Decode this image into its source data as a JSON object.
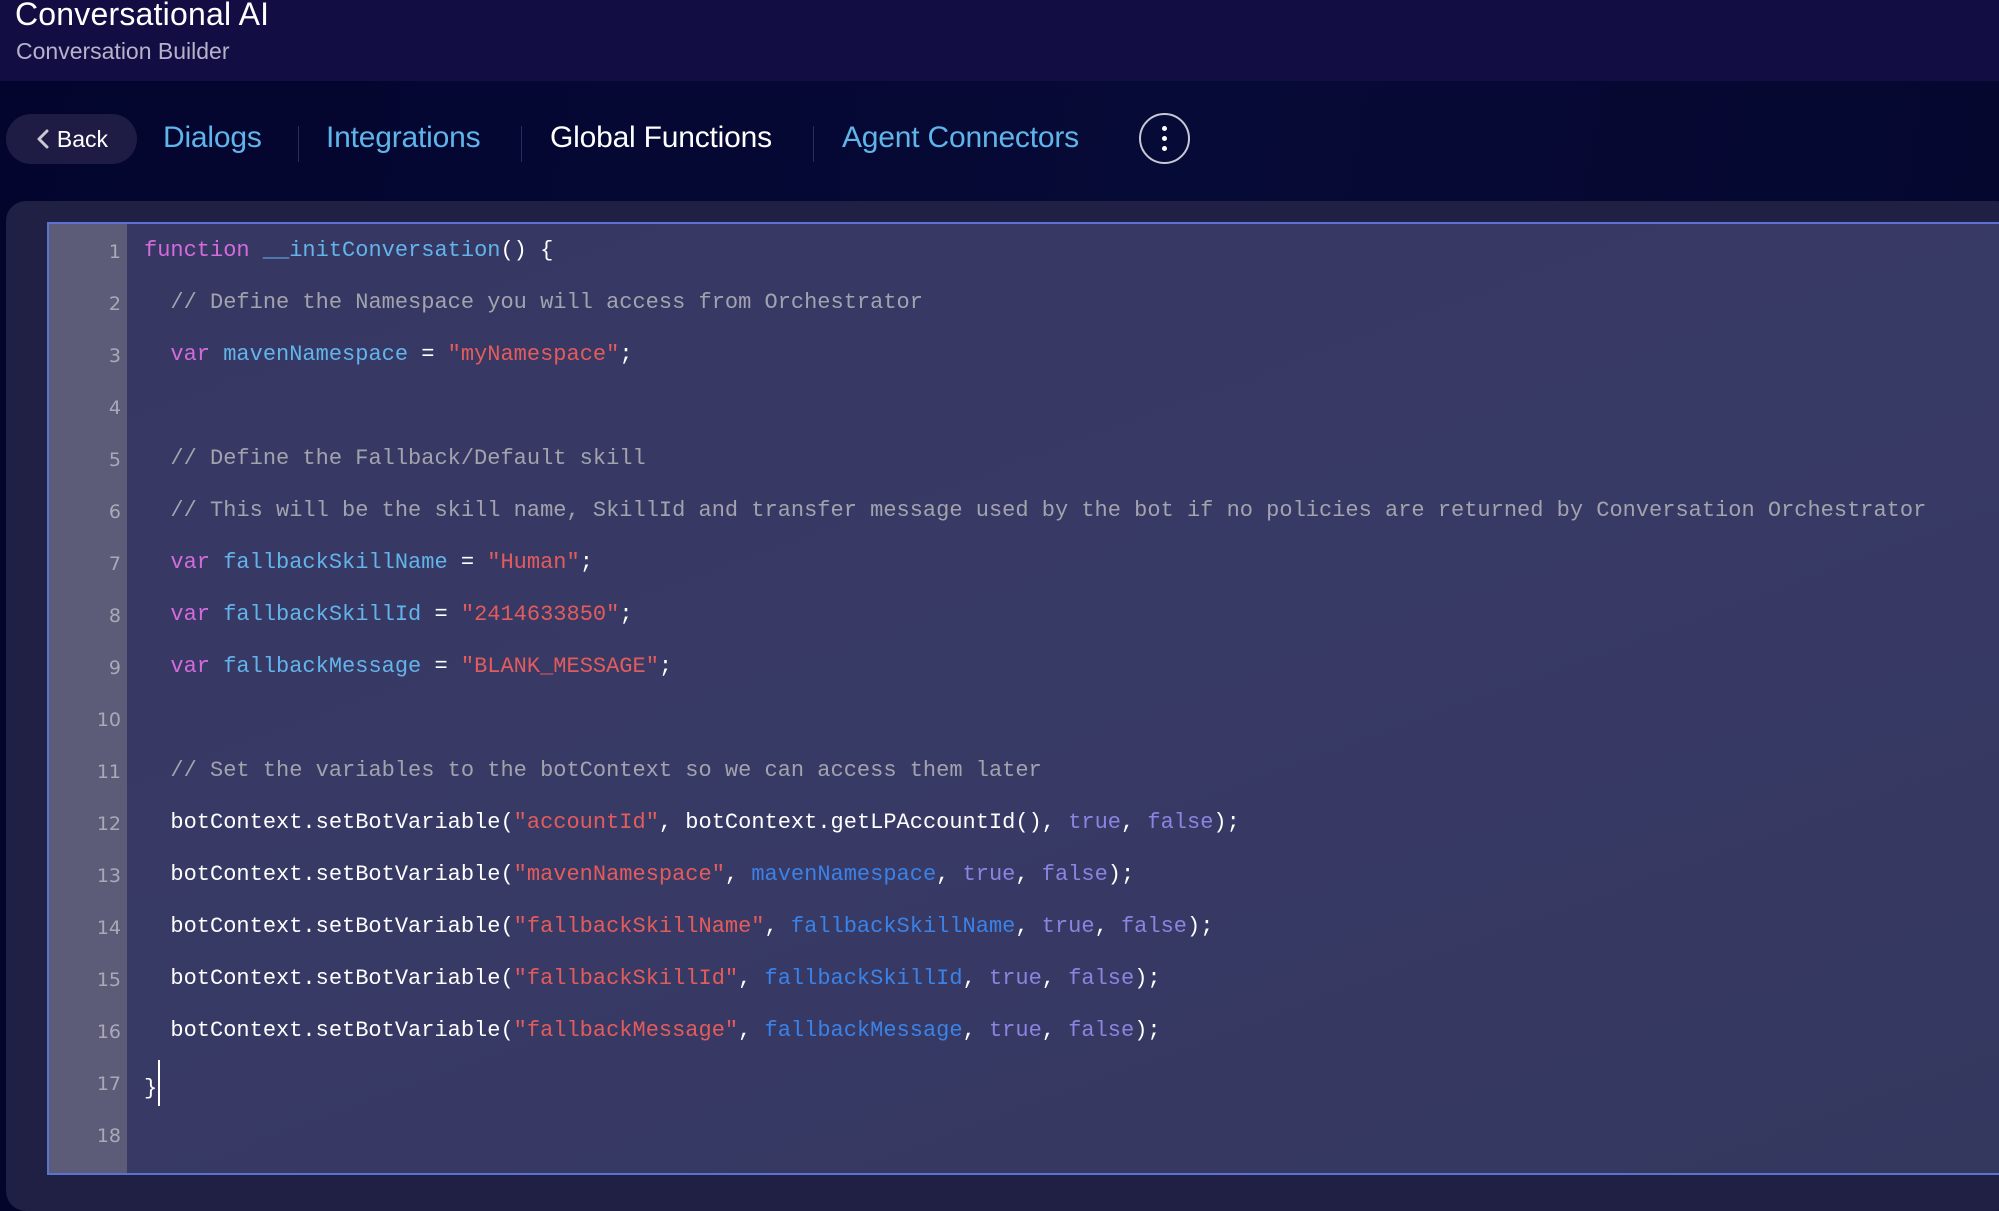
{
  "header": {
    "title": "Conversational AI",
    "subtitle": "Conversation Builder"
  },
  "nav": {
    "back_label": "Back",
    "tabs": [
      {
        "label": "Dialogs",
        "active": false
      },
      {
        "label": "Integrations",
        "active": false
      },
      {
        "label": "Global Functions",
        "active": true
      },
      {
        "label": "Agent Connectors",
        "active": false
      }
    ],
    "more_icon": "vertical-ellipsis-icon"
  },
  "colors": {
    "header_bg": "#120e44",
    "nav_bg": "#03052e",
    "tab_link": "#5fb4ea",
    "tab_active": "#ffffff",
    "editor_border": "#5a73d0",
    "keyword": "#d46bdc",
    "identifier": "#62b4ea",
    "reference": "#3b82e8",
    "string": "#e35c5c",
    "comment": "#a3a3ad",
    "boolean": "#8b84e0"
  },
  "editor": {
    "cursor_line": 17,
    "lines": [
      {
        "n": "1",
        "tokens": [
          {
            "t": "kw",
            "v": "function"
          },
          {
            "t": "plain",
            "v": " "
          },
          {
            "t": "fn",
            "v": "__initConversation"
          },
          {
            "t": "plain",
            "v": "() {"
          }
        ]
      },
      {
        "n": "2",
        "tokens": [
          {
            "t": "plain",
            "v": "  "
          },
          {
            "t": "com",
            "v": "// Define the Namespace you will access from Orchestrator"
          }
        ]
      },
      {
        "n": "3",
        "tokens": [
          {
            "t": "plain",
            "v": "  "
          },
          {
            "t": "kw",
            "v": "var"
          },
          {
            "t": "plain",
            "v": " "
          },
          {
            "t": "var",
            "v": "mavenNamespace"
          },
          {
            "t": "plain",
            "v": " = "
          },
          {
            "t": "str",
            "v": "\"myNamespace\""
          },
          {
            "t": "plain",
            "v": ";"
          }
        ]
      },
      {
        "n": "4",
        "tokens": []
      },
      {
        "n": "5",
        "tokens": [
          {
            "t": "plain",
            "v": "  "
          },
          {
            "t": "com",
            "v": "// Define the Fallback/Default skill"
          }
        ]
      },
      {
        "n": "6",
        "tokens": [
          {
            "t": "plain",
            "v": "  "
          },
          {
            "t": "com",
            "v": "// This will be the skill name, SkillId and transfer message used by the bot if no policies are returned by Conversation Orchestrator"
          }
        ]
      },
      {
        "n": "7",
        "tokens": [
          {
            "t": "plain",
            "v": "  "
          },
          {
            "t": "kw",
            "v": "var"
          },
          {
            "t": "plain",
            "v": " "
          },
          {
            "t": "var",
            "v": "fallbackSkillName"
          },
          {
            "t": "plain",
            "v": " = "
          },
          {
            "t": "str",
            "v": "\"Human\""
          },
          {
            "t": "plain",
            "v": ";"
          }
        ]
      },
      {
        "n": "8",
        "tokens": [
          {
            "t": "plain",
            "v": "  "
          },
          {
            "t": "kw",
            "v": "var"
          },
          {
            "t": "plain",
            "v": " "
          },
          {
            "t": "var",
            "v": "fallbackSkillId"
          },
          {
            "t": "plain",
            "v": " = "
          },
          {
            "t": "str",
            "v": "\"2414633850\""
          },
          {
            "t": "plain",
            "v": ";"
          }
        ]
      },
      {
        "n": "9",
        "tokens": [
          {
            "t": "plain",
            "v": "  "
          },
          {
            "t": "kw",
            "v": "var"
          },
          {
            "t": "plain",
            "v": " "
          },
          {
            "t": "var",
            "v": "fallbackMessage"
          },
          {
            "t": "plain",
            "v": " = "
          },
          {
            "t": "str",
            "v": "\"BLANK_MESSAGE\""
          },
          {
            "t": "plain",
            "v": ";"
          }
        ]
      },
      {
        "n": "10",
        "tokens": []
      },
      {
        "n": "11",
        "tokens": [
          {
            "t": "plain",
            "v": "  "
          },
          {
            "t": "com",
            "v": "// Set the variables to the botContext so we can access them later"
          }
        ]
      },
      {
        "n": "12",
        "tokens": [
          {
            "t": "plain",
            "v": "  botContext.setBotVariable("
          },
          {
            "t": "str",
            "v": "\"accountId\""
          },
          {
            "t": "plain",
            "v": ", botContext.getLPAccountId(), "
          },
          {
            "t": "bool",
            "v": "true"
          },
          {
            "t": "plain",
            "v": ", "
          },
          {
            "t": "bool",
            "v": "false"
          },
          {
            "t": "plain",
            "v": ");"
          }
        ]
      },
      {
        "n": "13",
        "tokens": [
          {
            "t": "plain",
            "v": "  botContext.setBotVariable("
          },
          {
            "t": "str",
            "v": "\"mavenNamespace\""
          },
          {
            "t": "plain",
            "v": ", "
          },
          {
            "t": "ref",
            "v": "mavenNamespace"
          },
          {
            "t": "plain",
            "v": ", "
          },
          {
            "t": "bool",
            "v": "true"
          },
          {
            "t": "plain",
            "v": ", "
          },
          {
            "t": "bool",
            "v": "false"
          },
          {
            "t": "plain",
            "v": ");"
          }
        ]
      },
      {
        "n": "14",
        "tokens": [
          {
            "t": "plain",
            "v": "  botContext.setBotVariable("
          },
          {
            "t": "str",
            "v": "\"fallbackSkillName\""
          },
          {
            "t": "plain",
            "v": ", "
          },
          {
            "t": "ref",
            "v": "fallbackSkillName"
          },
          {
            "t": "plain",
            "v": ", "
          },
          {
            "t": "bool",
            "v": "true"
          },
          {
            "t": "plain",
            "v": ", "
          },
          {
            "t": "bool",
            "v": "false"
          },
          {
            "t": "plain",
            "v": ");"
          }
        ]
      },
      {
        "n": "15",
        "tokens": [
          {
            "t": "plain",
            "v": "  botContext.setBotVariable("
          },
          {
            "t": "str",
            "v": "\"fallbackSkillId\""
          },
          {
            "t": "plain",
            "v": ", "
          },
          {
            "t": "ref",
            "v": "fallbackSkillId"
          },
          {
            "t": "plain",
            "v": ", "
          },
          {
            "t": "bool",
            "v": "true"
          },
          {
            "t": "plain",
            "v": ", "
          },
          {
            "t": "bool",
            "v": "false"
          },
          {
            "t": "plain",
            "v": ");"
          }
        ]
      },
      {
        "n": "16",
        "tokens": [
          {
            "t": "plain",
            "v": "  botContext.setBotVariable("
          },
          {
            "t": "str",
            "v": "\"fallbackMessage\""
          },
          {
            "t": "plain",
            "v": ", "
          },
          {
            "t": "ref",
            "v": "fallbackMessage"
          },
          {
            "t": "plain",
            "v": ", "
          },
          {
            "t": "bool",
            "v": "true"
          },
          {
            "t": "plain",
            "v": ", "
          },
          {
            "t": "bool",
            "v": "false"
          },
          {
            "t": "plain",
            "v": ");"
          }
        ]
      },
      {
        "n": "17",
        "tokens": [
          {
            "t": "plain",
            "v": "}"
          }
        ]
      },
      {
        "n": "18",
        "tokens": []
      }
    ]
  }
}
